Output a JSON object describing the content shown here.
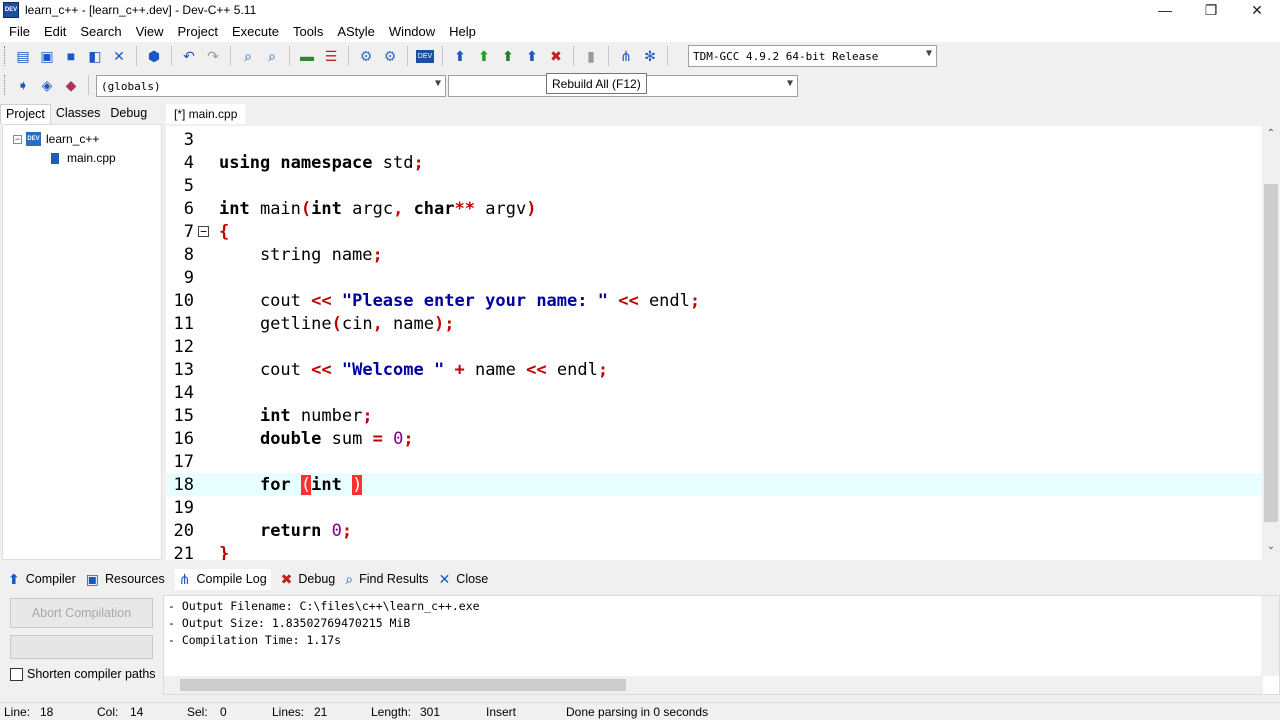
{
  "window": {
    "title": "learn_c++ - [learn_c++.dev] - Dev-C++ 5.11",
    "icon_text": "DEV",
    "minimize": "—",
    "restore": "❐",
    "close": "✕"
  },
  "menu": [
    "File",
    "Edit",
    "Search",
    "View",
    "Project",
    "Execute",
    "Tools",
    "AStyle",
    "Window",
    "Help"
  ],
  "toolbar": {
    "compiler_select": "TDM-GCC 4.9.2 64-bit Release",
    "globals_select": "(globals)",
    "function_select": "",
    "tooltip": "Rebuild All (F12)"
  },
  "left_panel": {
    "tabs": [
      "Project",
      "Classes",
      "Debug"
    ],
    "project_name": "learn_c++",
    "files": [
      "main.cpp"
    ],
    "dev_badge": "DEV"
  },
  "editor": {
    "tab_label": "[*] main.cpp",
    "current_line": 18,
    "lines": [
      {
        "num": "3",
        "code": ""
      },
      {
        "num": "4",
        "code": "using namespace std;"
      },
      {
        "num": "5",
        "code": ""
      },
      {
        "num": "6",
        "code": "int main(int argc, char** argv)"
      },
      {
        "num": "7",
        "code": "{"
      },
      {
        "num": "8",
        "code": "    string name;"
      },
      {
        "num": "9",
        "code": ""
      },
      {
        "num": "10",
        "code": "    cout << \"Please enter your name: \" << endl;"
      },
      {
        "num": "11",
        "code": "    getline(cin, name);"
      },
      {
        "num": "12",
        "code": ""
      },
      {
        "num": "13",
        "code": "    cout << \"Welcome \" + name << endl;"
      },
      {
        "num": "14",
        "code": ""
      },
      {
        "num": "15",
        "code": "    int number;"
      },
      {
        "num": "16",
        "code": "    double sum = 0;"
      },
      {
        "num": "17",
        "code": ""
      },
      {
        "num": "18",
        "code": "    for (int )"
      },
      {
        "num": "19",
        "code": ""
      },
      {
        "num": "20",
        "code": "    return 0;"
      },
      {
        "num": "21",
        "code": "}"
      }
    ]
  },
  "bottom_panel": {
    "tabs": [
      {
        "label": "Compiler",
        "icon": "compiler-icon"
      },
      {
        "label": "Resources",
        "icon": "resources-icon"
      },
      {
        "label": "Compile Log",
        "icon": "compile-log-icon"
      },
      {
        "label": "Debug",
        "icon": "debug-icon"
      },
      {
        "label": "Find Results",
        "icon": "find-results-icon"
      },
      {
        "label": "Close",
        "icon": "close-icon"
      }
    ],
    "abort_button": "Abort Compilation",
    "shorten_paths": "Shorten compiler paths",
    "log": [
      "- Output Filename: C:\\files\\c++\\learn_c++.exe",
      "- Output Size: 1.83502769470215 MiB",
      "- Compilation Time: 1.17s"
    ]
  },
  "status": {
    "line_label": "Line:",
    "line": "18",
    "col_label": "Col:",
    "col": "14",
    "sel_label": "Sel:",
    "sel": "0",
    "lines_label": "Lines:",
    "lines": "21",
    "length_label": "Length:",
    "length": "301",
    "mode": "Insert",
    "message": "Done parsing in 0 seconds"
  }
}
